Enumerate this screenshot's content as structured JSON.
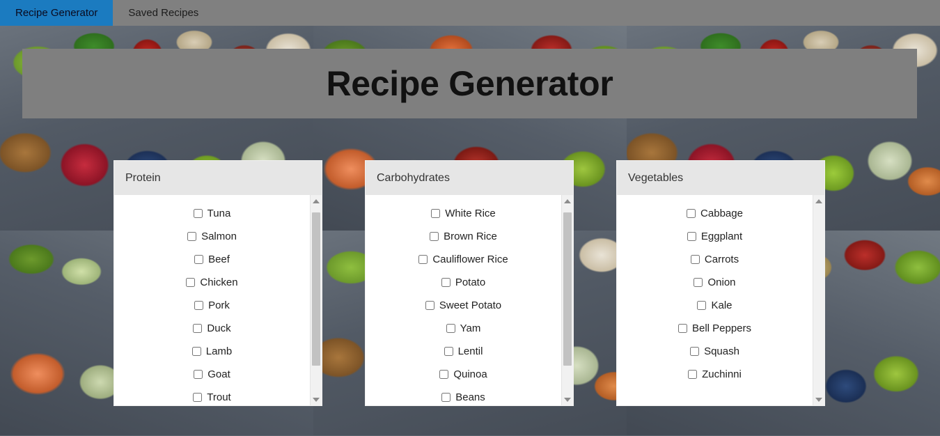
{
  "tabs": [
    {
      "label": "Recipe Generator",
      "active": true
    },
    {
      "label": "Saved Recipes",
      "active": false
    }
  ],
  "banner": {
    "title": "Recipe Generator",
    "background_color": "#7f7f7f",
    "text_color": "#111111"
  },
  "theme": {
    "tabbar_color": "#808080",
    "active_tab_color": "#1b7bc0",
    "panel_header_color": "#e6e6e6",
    "panel_body_color": "#ffffff",
    "scrollbar_track_color": "#f1f1f1",
    "scrollbar_thumb_color": "#c2c2c2"
  },
  "panels": [
    {
      "title": "Protein",
      "scroll_thumb": {
        "visible": true,
        "top_pct": 3,
        "height_pct": 82
      },
      "items": [
        {
          "label": "Tuna",
          "checked": false
        },
        {
          "label": "Salmon",
          "checked": false
        },
        {
          "label": "Beef",
          "checked": false
        },
        {
          "label": "Chicken",
          "checked": false
        },
        {
          "label": "Pork",
          "checked": false
        },
        {
          "label": "Duck",
          "checked": false
        },
        {
          "label": "Lamb",
          "checked": false
        },
        {
          "label": "Goat",
          "checked": false
        },
        {
          "label": "Trout",
          "checked": false
        }
      ]
    },
    {
      "title": "Carbohydrates",
      "scroll_thumb": {
        "visible": true,
        "top_pct": 3,
        "height_pct": 82
      },
      "items": [
        {
          "label": "White Rice",
          "checked": false
        },
        {
          "label": "Brown Rice",
          "checked": false
        },
        {
          "label": "Cauliflower Rice",
          "checked": false
        },
        {
          "label": "Potato",
          "checked": false
        },
        {
          "label": "Sweet Potato",
          "checked": false
        },
        {
          "label": "Yam",
          "checked": false
        },
        {
          "label": "Lentil",
          "checked": false
        },
        {
          "label": "Quinoa",
          "checked": false
        },
        {
          "label": "Beans",
          "checked": false
        }
      ]
    },
    {
      "title": "Vegetables",
      "scroll_thumb": {
        "visible": false,
        "top_pct": 0,
        "height_pct": 0
      },
      "items": [
        {
          "label": "Cabbage",
          "checked": false
        },
        {
          "label": "Eggplant",
          "checked": false
        },
        {
          "label": "Carrots",
          "checked": false
        },
        {
          "label": "Onion",
          "checked": false
        },
        {
          "label": "Kale",
          "checked": false
        },
        {
          "label": "Bell Peppers",
          "checked": false
        },
        {
          "label": "Squash",
          "checked": false
        },
        {
          "label": "Zuchinni",
          "checked": false
        }
      ]
    }
  ],
  "background": {
    "description": "tiled food photograph of fresh produce on slate"
  }
}
